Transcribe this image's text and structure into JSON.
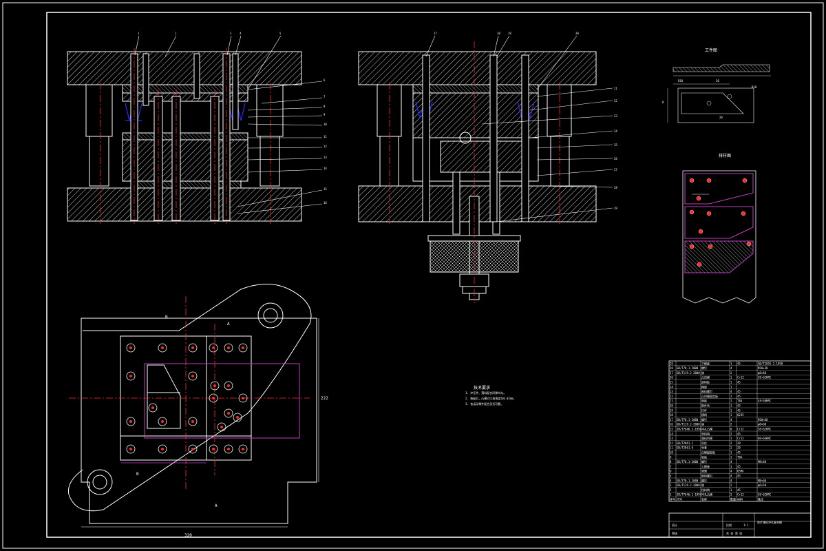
{
  "drawing": {
    "section_labels": {
      "a": "A",
      "b": "B"
    },
    "callouts_left": [
      "1",
      "2",
      "3",
      "4",
      "5",
      "6",
      "7",
      "8",
      "9",
      "10",
      "11",
      "12",
      "13",
      "14",
      "15",
      "16"
    ],
    "callouts_right": [
      "17",
      "18",
      "19",
      "20",
      "21",
      "22",
      "23",
      "24",
      "25",
      "26",
      "27",
      "28",
      "29"
    ],
    "strip_title": "排样图",
    "part_title": "工件图",
    "part_dims": [
      "R10",
      "20",
      "R10",
      "8",
      "20"
    ],
    "plan_dims": {
      "width": "320",
      "height": "222"
    },
    "tech_req": {
      "title": "技术要求",
      "lines": [
        "1. 冲压件、落料配合间隙均匀。",
        "2. 装配后，凸模刃口垂直度为0.02mm。",
        "3. 各运动零件配合灵活可靠。"
      ]
    }
  },
  "bom": {
    "headers": {
      "no": "序号",
      "code": "代号",
      "name": "名称",
      "qty": "数量",
      "material": "材料",
      "note": "备注"
    },
    "rows": [
      {
        "no": "29",
        "code": "",
        "name": "下模座",
        "qty": "1",
        "material": "45",
        "note": "GB/T2855.2-1990"
      },
      {
        "no": "28",
        "code": "GB/T70.1-2000",
        "name": "螺钉",
        "qty": "4",
        "material": "",
        "note": "M10×30"
      },
      {
        "no": "27",
        "code": "GB/T119.2-2000",
        "name": "销",
        "qty": "2",
        "material": "",
        "note": "φ8×40"
      },
      {
        "no": "26",
        "code": "",
        "name": "凸凹模",
        "qty": "1",
        "material": "Cr12",
        "note": "58~62HRC"
      },
      {
        "no": "25",
        "code": "",
        "name": "卸料板",
        "qty": "1",
        "material": "45",
        "note": ""
      },
      {
        "no": "24",
        "code": "",
        "name": "橡胶",
        "qty": "1",
        "material": "",
        "note": ""
      },
      {
        "no": "23",
        "code": "",
        "name": "卸料螺钉",
        "qty": "4",
        "material": "45",
        "note": ""
      },
      {
        "no": "22",
        "code": "",
        "name": "凸凹模固定板",
        "qty": "1",
        "material": "45",
        "note": ""
      },
      {
        "no": "21",
        "code": "",
        "name": "垫板",
        "qty": "1",
        "material": "T8A",
        "note": "54~58HRC"
      },
      {
        "no": "20",
        "code": "",
        "name": "推件块",
        "qty": "1",
        "material": "45",
        "note": ""
      },
      {
        "no": "19",
        "code": "",
        "name": "打杆",
        "qty": "1",
        "material": "45",
        "note": ""
      },
      {
        "no": "18",
        "code": "",
        "name": "模柄",
        "qty": "1",
        "material": "Q235",
        "note": ""
      },
      {
        "no": "17",
        "code": "GB/T70.1-2000",
        "name": "螺钉",
        "qty": "4",
        "material": "",
        "note": "M10×60"
      },
      {
        "no": "16",
        "code": "GB/T119.2-2000",
        "name": "销",
        "qty": "2",
        "material": "",
        "note": "φ8×60"
      },
      {
        "no": "15",
        "code": "JB/T7646.1-1994",
        "name": "冲孔凸模",
        "qty": "6",
        "material": "Cr12",
        "note": "58~62HRC"
      },
      {
        "no": "14",
        "code": "",
        "name": "导料销",
        "qty": "2",
        "material": "45",
        "note": ""
      },
      {
        "no": "13",
        "code": "",
        "name": "落料凹模",
        "qty": "1",
        "material": "Cr12",
        "note": "60~64HRC"
      },
      {
        "no": "12",
        "code": "GB/T2861.1",
        "name": "导柱",
        "qty": "2",
        "material": "20",
        "note": ""
      },
      {
        "no": "11",
        "code": "GB/T2861.6",
        "name": "导套",
        "qty": "2",
        "material": "20",
        "note": ""
      },
      {
        "no": "10",
        "code": "",
        "name": "凸模固定板",
        "qty": "1",
        "material": "45",
        "note": ""
      },
      {
        "no": "9",
        "code": "",
        "name": "垫板",
        "qty": "1",
        "material": "T8A",
        "note": ""
      },
      {
        "no": "8",
        "code": "GB/T70.1-2000",
        "name": "螺钉",
        "qty": "4",
        "material": "",
        "note": "M8×40"
      },
      {
        "no": "7",
        "code": "",
        "name": "上模座",
        "qty": "1",
        "material": "45",
        "note": ""
      },
      {
        "no": "6",
        "code": "",
        "name": "弹簧",
        "qty": "4",
        "material": "65Mn",
        "note": ""
      },
      {
        "no": "5",
        "code": "",
        "name": "卸料螺钉",
        "qty": "4",
        "material": "45",
        "note": ""
      },
      {
        "no": "4",
        "code": "GB/T70.1-2000",
        "name": "螺钉",
        "qty": "4",
        "material": "",
        "note": "M8×60"
      },
      {
        "no": "3",
        "code": "GB/T119.2-2000",
        "name": "销",
        "qty": "2",
        "material": "",
        "note": "φ6×50"
      },
      {
        "no": "2",
        "code": "",
        "name": "挡料销",
        "qty": "1",
        "material": "45",
        "note": ""
      },
      {
        "no": "1",
        "code": "JB/T7646.1-1994",
        "name": "冲孔凸模",
        "qty": "2",
        "material": "Cr12",
        "note": "58~62HRC"
      }
    ]
  },
  "title_block": {
    "title": "垫片落料冲孔复合模",
    "scale_label": "比例",
    "scale": "1:1",
    "designer": "设计",
    "checker": "审核",
    "sheet": "共 张 第 张"
  }
}
